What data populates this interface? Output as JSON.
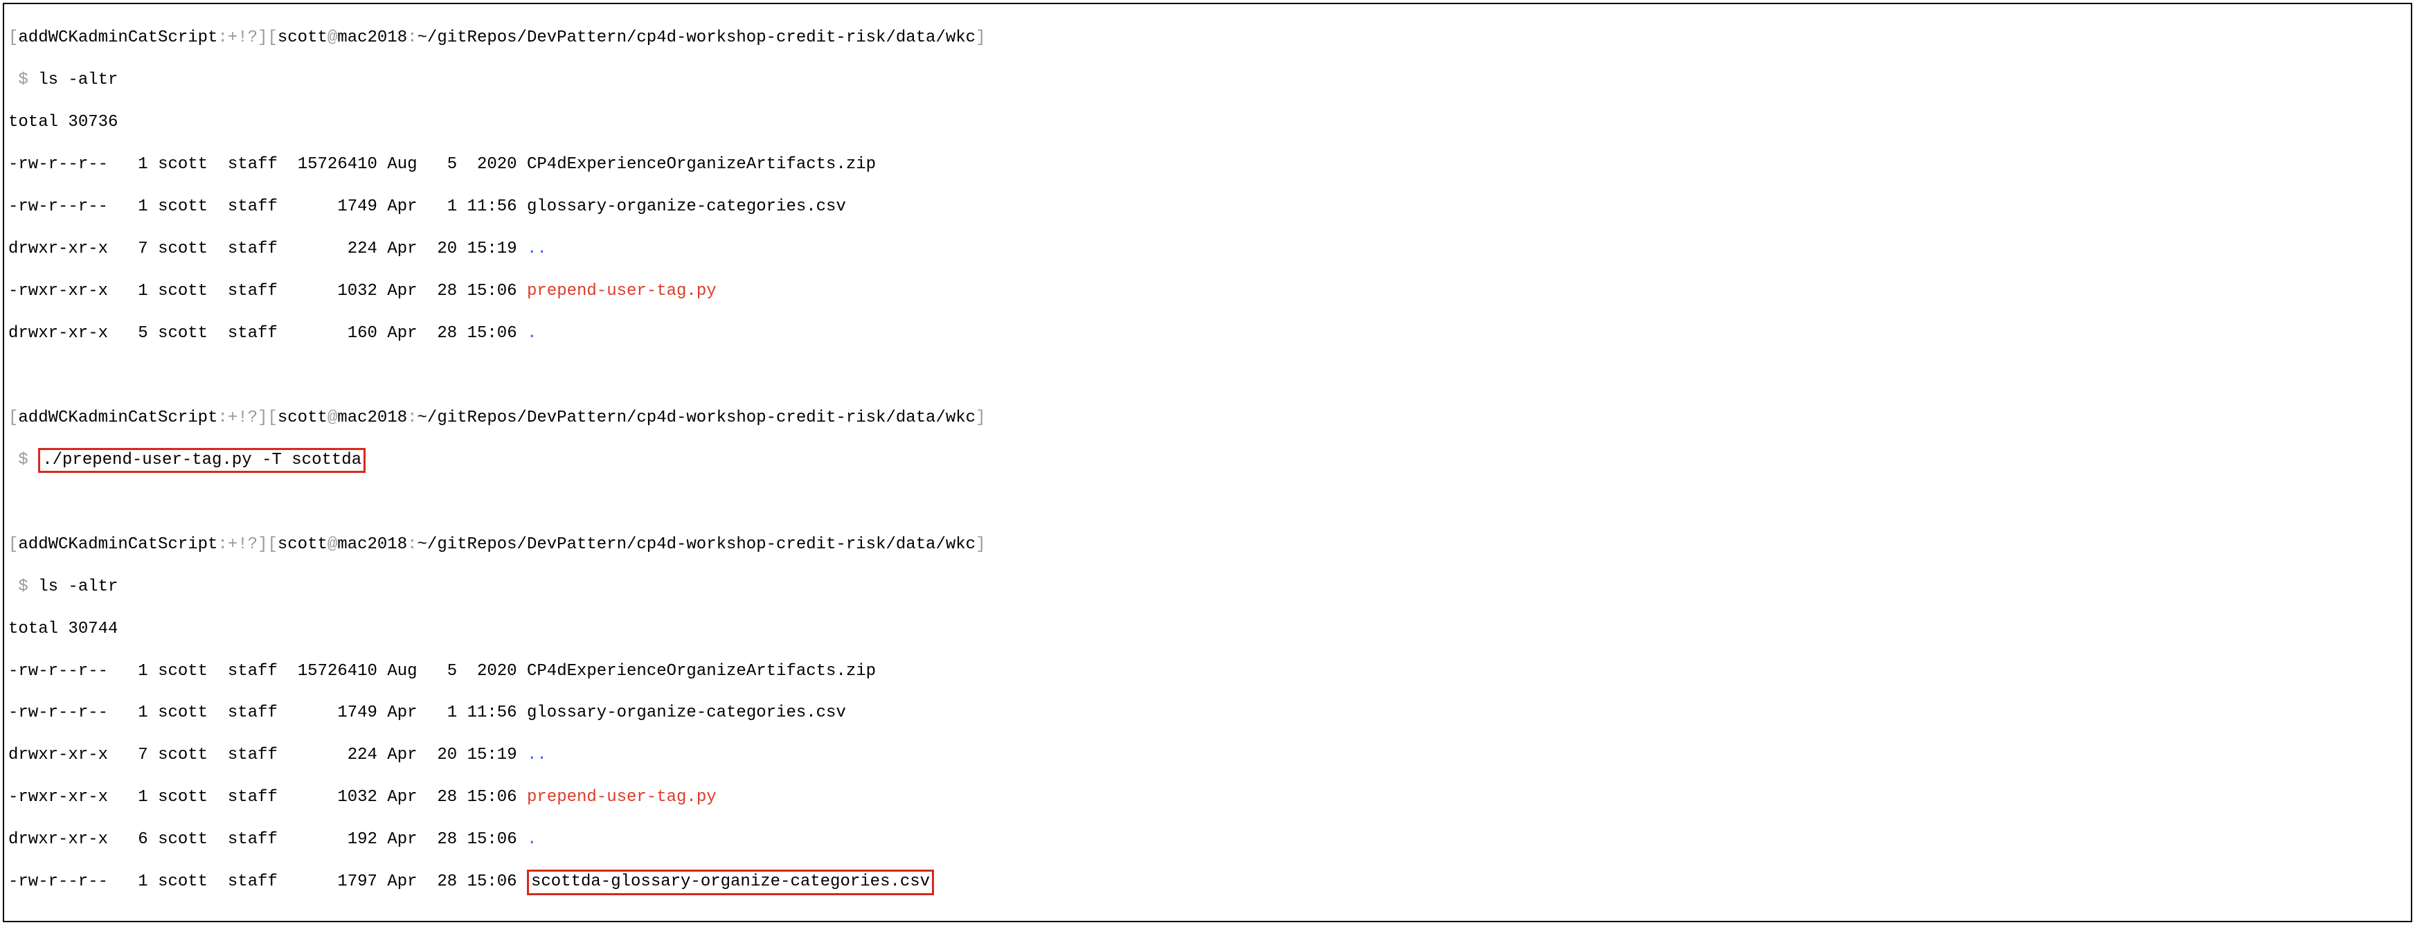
{
  "prompt": {
    "lb": "[",
    "rb": "]",
    "branch": "addWCKadminCatScript",
    "flags": ":+!?",
    "user": "scott",
    "at": "@",
    "host": "mac2018",
    "sep": ":",
    "path": "~/gitRepos/DevPattern/cp4d-workshop-credit-risk/data/wkc",
    "dollar": " $ "
  },
  "cmd1": "ls -altr",
  "out1": {
    "total": "total 30736",
    "r0": {
      "perm": "-rw-r--r--",
      "links": "1",
      "u": "scott",
      "g": "staff",
      "size": "15726410",
      "date": "Aug   5  2020",
      "name": "CP4dExperienceOrganizeArtifacts.zip"
    },
    "r1": {
      "perm": "-rw-r--r--",
      "links": "1",
      "u": "scott",
      "g": "staff",
      "size": "1749",
      "date": "Apr   1 11:56",
      "name": "glossary-organize-categories.csv"
    },
    "r2": {
      "perm": "drwxr-xr-x",
      "links": "7",
      "u": "scott",
      "g": "staff",
      "size": "224",
      "date": "Apr  20 15:19",
      "name": ".."
    },
    "r3": {
      "perm": "-rwxr-xr-x",
      "links": "1",
      "u": "scott",
      "g": "staff",
      "size": "1032",
      "date": "Apr  28 15:06",
      "name": "prepend-user-tag.py"
    },
    "r4": {
      "perm": "drwxr-xr-x",
      "links": "5",
      "u": "scott",
      "g": "staff",
      "size": "160",
      "date": "Apr  28 15:06",
      "name": "."
    }
  },
  "cmd2": "./prepend-user-tag.py -T scottda",
  "cmd3": "ls -altr",
  "out2": {
    "total": "total 30744",
    "r0": {
      "perm": "-rw-r--r--",
      "links": "1",
      "u": "scott",
      "g": "staff",
      "size": "15726410",
      "date": "Aug   5  2020",
      "name": "CP4dExperienceOrganizeArtifacts.zip"
    },
    "r1": {
      "perm": "-rw-r--r--",
      "links": "1",
      "u": "scott",
      "g": "staff",
      "size": "1749",
      "date": "Apr   1 11:56",
      "name": "glossary-organize-categories.csv"
    },
    "r2": {
      "perm": "drwxr-xr-x",
      "links": "7",
      "u": "scott",
      "g": "staff",
      "size": "224",
      "date": "Apr  20 15:19",
      "name": ".."
    },
    "r3": {
      "perm": "-rwxr-xr-x",
      "links": "1",
      "u": "scott",
      "g": "staff",
      "size": "1032",
      "date": "Apr  28 15:06",
      "name": "prepend-user-tag.py"
    },
    "r4": {
      "perm": "drwxr-xr-x",
      "links": "6",
      "u": "scott",
      "g": "staff",
      "size": "192",
      "date": "Apr  28 15:06",
      "name": "."
    },
    "r5": {
      "perm": "-rw-r--r--",
      "links": "1",
      "u": "scott",
      "g": "staff",
      "size": "1797",
      "date": "Apr  28 15:06",
      "name": "scottda-glossary-organize-categories.csv"
    }
  }
}
